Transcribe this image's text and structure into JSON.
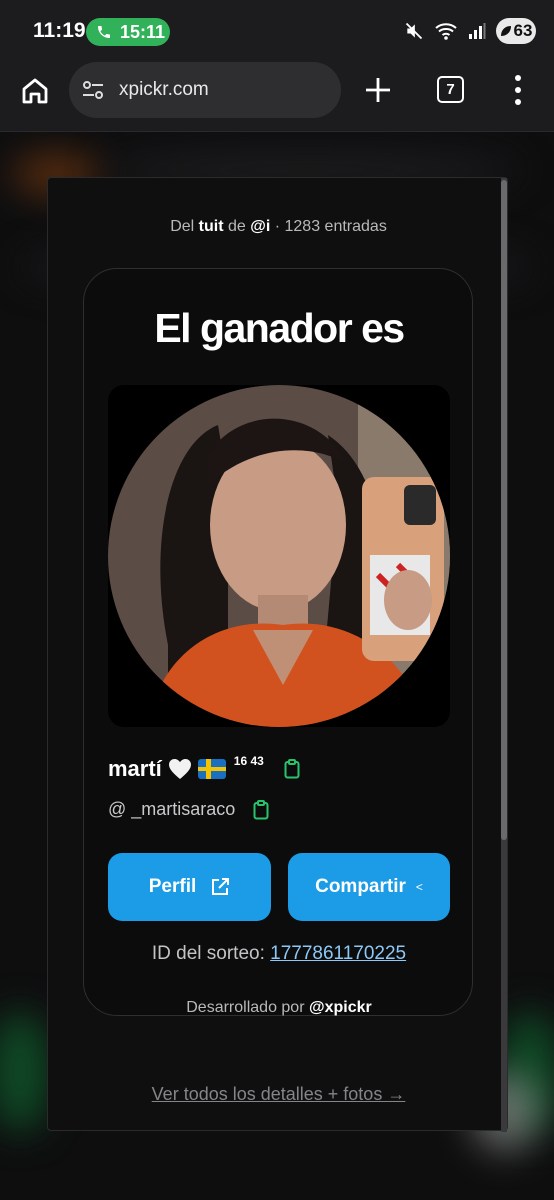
{
  "status_bar": {
    "time": "11:19",
    "call_timer": "15:11",
    "battery": "63"
  },
  "browser": {
    "url": "xpickr.com",
    "tab_count": "7"
  },
  "modal": {
    "entries_prefix": "Del",
    "entries_tweet": "tuit",
    "entries_de": "de",
    "entries_user": "@i",
    "entries_count": "· 1283 entradas",
    "title": "El ganador es",
    "winner_name": "martí",
    "winner_superscript": "16 43",
    "winner_handle": "@ _martisaraco",
    "profile_button": "Perfil",
    "share_button": "Compartir",
    "share_glyph": "<",
    "raffle_label": "ID del sorteo:",
    "raffle_id": "1777861170225",
    "dev_prefix": "Desarrollado por",
    "dev_handle": "@xpickr",
    "details_link": "Ver todos los detalles + fotos →"
  },
  "colors": {
    "accent_button": "#1c9be6",
    "link": "#8ec8f5",
    "copy_icon": "#27c46b",
    "call_pill": "#31b15a"
  },
  "icons": [
    "phone-icon",
    "mute-icon",
    "wifi-icon",
    "signal-icon",
    "home-icon",
    "site-settings-icon",
    "plus-icon",
    "more-icon",
    "copy-icon",
    "external-link-icon"
  ]
}
